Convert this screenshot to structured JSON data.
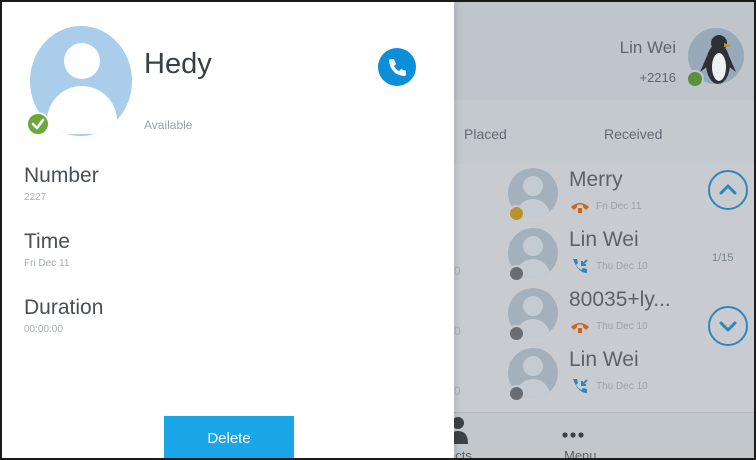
{
  "background": {
    "user": {
      "name": "Lin Wei",
      "number": "+2216"
    },
    "tabs": [
      "Placed",
      "Received"
    ],
    "entries": [
      {
        "name": "Merry",
        "date": "Fri Dec 11",
        "type": "missed",
        "presence": "away",
        "stub": ""
      },
      {
        "name": "Lin Wei",
        "date": "Thu Dec 10",
        "type": "received",
        "presence": "offline",
        "stub": "0"
      },
      {
        "name": "80035+ly...",
        "date": "Thu Dec 10",
        "type": "missed",
        "presence": "offline",
        "stub": "0"
      },
      {
        "name": "Lin Wei",
        "date": "Thu Dec 10",
        "type": "received",
        "presence": "offline",
        "stub": "0"
      }
    ],
    "page_count": "1/15",
    "bottom_nav": {
      "contacts_label": "acts",
      "menu_label": "Menu"
    }
  },
  "detail": {
    "name": "Hedy",
    "status": "Available",
    "fields": {
      "number": {
        "label": "Number",
        "value": "2227"
      },
      "time": {
        "label": "Time",
        "value": "Fri Dec 11"
      },
      "duration": {
        "label": "Duration",
        "value": "00:00:00"
      }
    },
    "delete_label": "Delete"
  },
  "icons": {
    "call": "phone-icon",
    "status_available": "check-icon",
    "scroll_up": "chevron-up-icon",
    "scroll_down": "chevron-down-icon",
    "contacts": "person-icon",
    "menu": "more-dots-icon",
    "missed_call": "missed-call-icon",
    "received_call": "received-call-icon"
  },
  "colors": {
    "accent": "#1aa7e8",
    "call_button": "#0c8ed8",
    "available": "#6aa83b",
    "avatar_bg": "#a9cdea",
    "missed_call": "#c8641e",
    "received_call": "#2f86bb"
  }
}
